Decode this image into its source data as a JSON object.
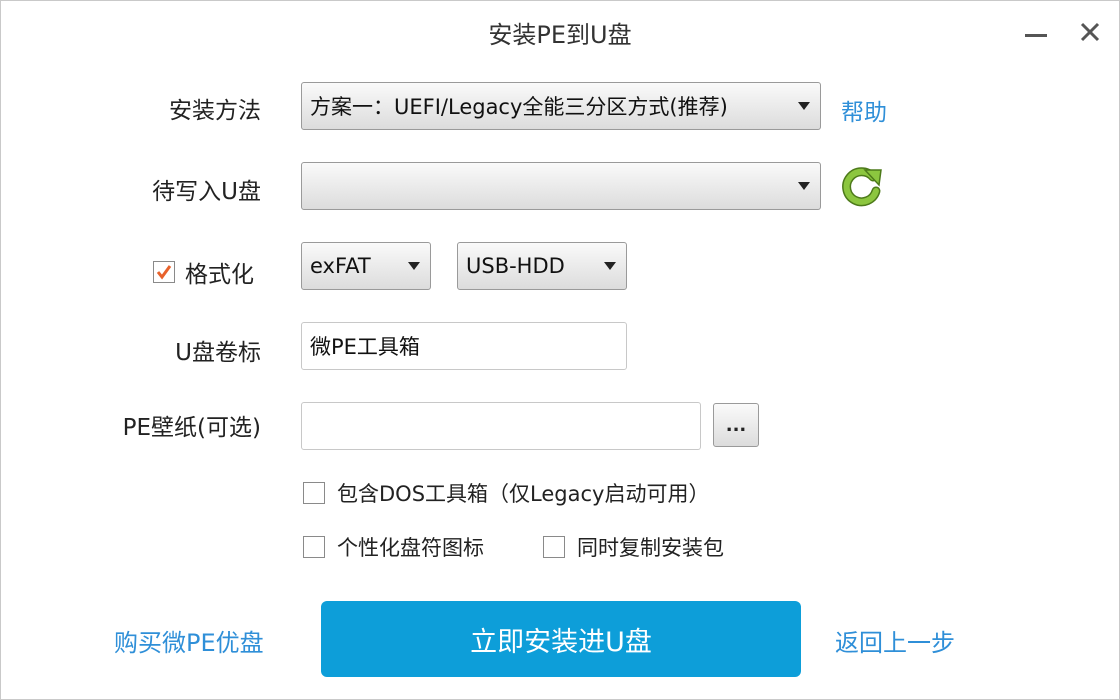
{
  "window": {
    "title": "安装PE到U盘"
  },
  "form": {
    "install_method": {
      "label": "安装方法",
      "value": "方案一：UEFI/Legacy全能三分区方式(推荐)",
      "help_link": "帮助"
    },
    "target_disk": {
      "label": "待写入U盘",
      "value": ""
    },
    "format": {
      "label": "格式化",
      "checked": true,
      "filesystem": "exFAT",
      "mode": "USB-HDD"
    },
    "volume_label": {
      "label": "U盘卷标",
      "value": "微PE工具箱"
    },
    "wallpaper": {
      "label": "PE壁纸(可选)",
      "value": "",
      "browse_label": "..."
    },
    "options": [
      {
        "label": "包含DOS工具箱（仅Legacy启动可用）",
        "checked": false
      },
      {
        "label": "个性化盘符图标",
        "checked": false
      },
      {
        "label": "同时复制安装包",
        "checked": false
      }
    ]
  },
  "footer": {
    "buy_link": "购买微PE优盘",
    "install_button": "立即安装进U盘",
    "back_link": "返回上一步"
  },
  "colors": {
    "accent": "#0d9ed9",
    "link": "#2f8fd8",
    "check": "#e8622c",
    "refresh": "#8cc63f"
  }
}
